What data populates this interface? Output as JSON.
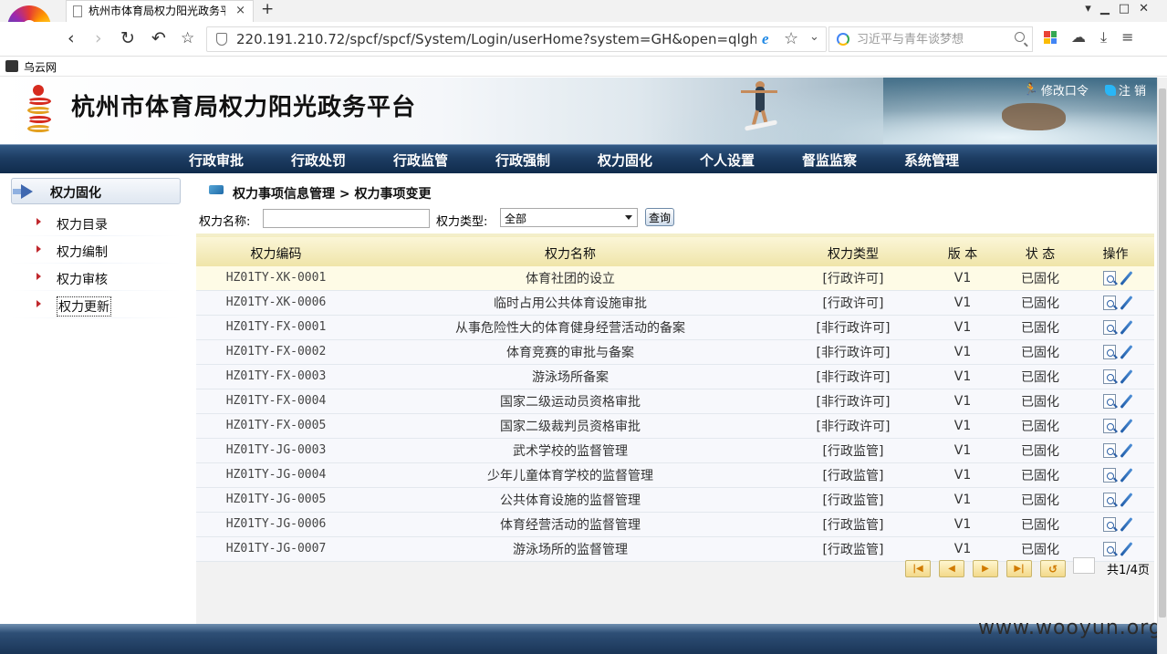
{
  "browser": {
    "tab_title": "杭州市体育局权力阳光政务平",
    "url": "220.191.210.72/spcf/spcf/System/Login/userHome?system=GH&open=qlgh&",
    "search_placeholder": "习近平与青年谈梦想",
    "bookmark": "乌云网"
  },
  "header": {
    "title": "杭州市体育局权力阳光政务平台",
    "links": [
      "修改口令",
      "注 销"
    ]
  },
  "nav": [
    "行政审批",
    "行政处罚",
    "行政监管",
    "行政强制",
    "权力固化",
    "个人设置",
    "督监监察",
    "系统管理"
  ],
  "sidebar": {
    "title": "权力固化",
    "items": [
      "权力目录",
      "权力编制",
      "权力审核",
      "权力更新"
    ]
  },
  "breadcrumb": "权力事项信息管理 > 权力事项变更",
  "filter": {
    "name_label": "权力名称:",
    "name_value": "",
    "type_label": "权力类型:",
    "type_selected": "全部",
    "query_button": "查询"
  },
  "table": {
    "headers": [
      "权力编码",
      "权力名称",
      "权力类型",
      "版 本",
      "状 态",
      "操作"
    ],
    "rows": [
      [
        "HZ01TY-XK-0001",
        "体育社团的设立",
        "[行政许可]",
        "V1",
        "已固化"
      ],
      [
        "HZ01TY-XK-0006",
        "临时占用公共体育设施审批",
        "[行政许可]",
        "V1",
        "已固化"
      ],
      [
        "HZ01TY-FX-0001",
        "从事危险性大的体育健身经营活动的备案",
        "[非行政许可]",
        "V1",
        "已固化"
      ],
      [
        "HZ01TY-FX-0002",
        "体育竞赛的审批与备案",
        "[非行政许可]",
        "V1",
        "已固化"
      ],
      [
        "HZ01TY-FX-0003",
        "游泳场所备案",
        "[非行政许可]",
        "V1",
        "已固化"
      ],
      [
        "HZ01TY-FX-0004",
        "国家二级运动员资格审批",
        "[非行政许可]",
        "V1",
        "已固化"
      ],
      [
        "HZ01TY-FX-0005",
        "国家二级裁判员资格审批",
        "[非行政许可]",
        "V1",
        "已固化"
      ],
      [
        "HZ01TY-JG-0003",
        "武术学校的监督管理",
        "[行政监管]",
        "V1",
        "已固化"
      ],
      [
        "HZ01TY-JG-0004",
        "少年儿童体育学校的监督管理",
        "[行政监管]",
        "V1",
        "已固化"
      ],
      [
        "HZ01TY-JG-0005",
        "公共体育设施的监督管理",
        "[行政监管]",
        "V1",
        "已固化"
      ],
      [
        "HZ01TY-JG-0006",
        "体育经营活动的监督管理",
        "[行政监管]",
        "V1",
        "已固化"
      ],
      [
        "HZ01TY-JG-0007",
        "游泳场所的监督管理",
        "[行政监管]",
        "V1",
        "已固化"
      ]
    ]
  },
  "pager": {
    "page_input": "",
    "total": "共1/4页"
  },
  "watermark": "www.wooyun.org",
  "colors": {
    "nav_bg": "#1d3d63",
    "header_row_bg": "#efe4a8",
    "highlight_row": "#fefbe6",
    "bullet": "#c0282d"
  }
}
